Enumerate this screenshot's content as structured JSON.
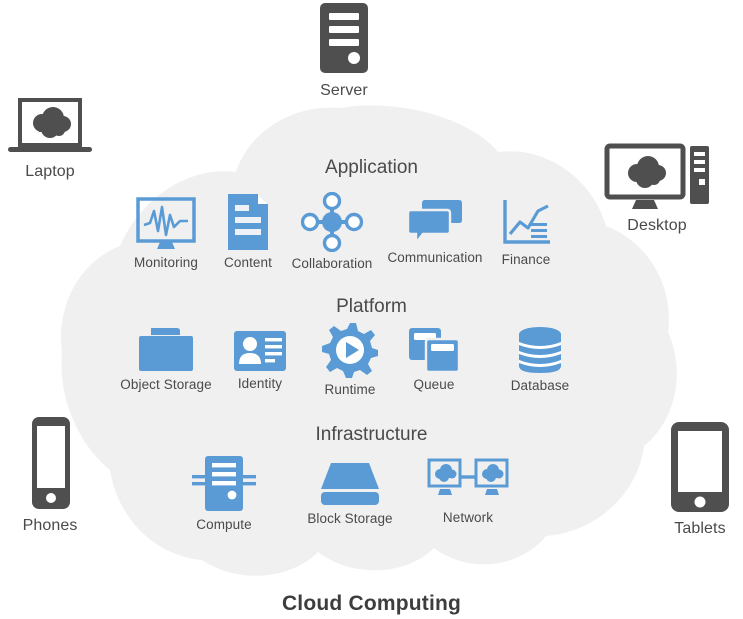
{
  "diagram": {
    "title": "Cloud Computing",
    "colors": {
      "cloud_fill": "#f0f0f0",
      "service_blue": "#5b9bd5",
      "device_gray": "#4f4f4f",
      "text_gray": "#4a4a4a",
      "background": "#ffffff"
    }
  },
  "sections": [
    {
      "id": "application",
      "label": "Application"
    },
    {
      "id": "platform",
      "label": "Platform"
    },
    {
      "id": "infrastructure",
      "label": "Infrastructure"
    }
  ],
  "edge_devices": [
    {
      "id": "server",
      "label": "Server",
      "icon": "server-tower-icon",
      "position": "top"
    },
    {
      "id": "laptop",
      "label": "Laptop",
      "icon": "laptop-cloud-icon",
      "position": "top-left"
    },
    {
      "id": "desktop",
      "label": "Desktop",
      "icon": "desktop-cloud-icon",
      "position": "top-right"
    },
    {
      "id": "phones",
      "label": "Phones",
      "icon": "smartphone-icon",
      "position": "bottom-left"
    },
    {
      "id": "tablets",
      "label": "Tablets",
      "icon": "tablet-icon",
      "position": "bottom-right"
    }
  ],
  "application_services": [
    {
      "id": "monitoring",
      "label": "Monitoring",
      "icon": "monitor-waveform-icon"
    },
    {
      "id": "content",
      "label": "Content",
      "icon": "document-icon"
    },
    {
      "id": "collaboration",
      "label": "Collaboration",
      "icon": "node-network-icon"
    },
    {
      "id": "communication",
      "label": "Communication",
      "icon": "speech-bubbles-icon"
    },
    {
      "id": "finance",
      "label": "Finance",
      "icon": "line-chart-icon"
    }
  ],
  "platform_services": [
    {
      "id": "object-storage",
      "label": "Object Storage",
      "icon": "folder-icon"
    },
    {
      "id": "identity",
      "label": "Identity",
      "icon": "id-card-icon"
    },
    {
      "id": "runtime",
      "label": "Runtime",
      "icon": "gear-play-icon"
    },
    {
      "id": "queue",
      "label": "Queue",
      "icon": "stacked-cards-icon"
    },
    {
      "id": "database",
      "label": "Database",
      "icon": "database-cylinder-icon"
    }
  ],
  "infrastructure_services": [
    {
      "id": "compute",
      "label": "Compute",
      "icon": "server-rack-icon"
    },
    {
      "id": "block-storage",
      "label": "Block Storage",
      "icon": "disk-drive-icon"
    },
    {
      "id": "network",
      "label": "Network",
      "icon": "two-monitors-link-icon"
    }
  ]
}
